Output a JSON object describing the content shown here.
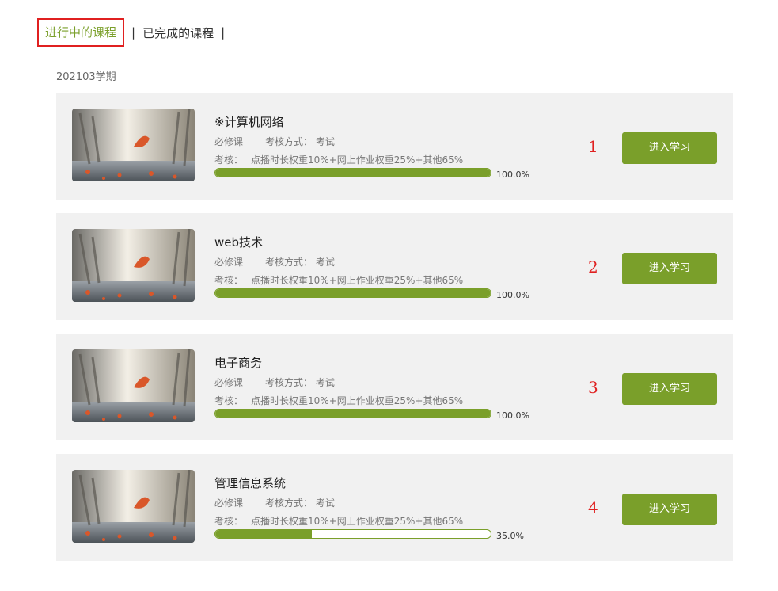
{
  "tabs": {
    "active_label": "进行中的课程",
    "sep": "|",
    "completed_label": "已完成的课程"
  },
  "semester": "202103学期",
  "courses": [
    {
      "title": "※计算机网络",
      "type": "必修课",
      "exam_mode": "考核方式：  考试",
      "assess_label": "考核：",
      "assess_detail": "点播时长权重10%+网上作业权重25%+其他65%",
      "progress_pct": 100,
      "progress_text": "100.0%",
      "annotation": "1",
      "enter_label": "进入学习"
    },
    {
      "title": "web技术",
      "type": "必修课",
      "exam_mode": "考核方式：  考试",
      "assess_label": "考核：",
      "assess_detail": "点播时长权重10%+网上作业权重25%+其他65%",
      "progress_pct": 100,
      "progress_text": "100.0%",
      "annotation": "2",
      "enter_label": "进入学习"
    },
    {
      "title": "电子商务",
      "type": "必修课",
      "exam_mode": "考核方式：  考试",
      "assess_label": "考核：",
      "assess_detail": "点播时长权重10%+网上作业权重25%+其他65%",
      "progress_pct": 100,
      "progress_text": "100.0%",
      "annotation": "3",
      "enter_label": "进入学习"
    },
    {
      "title": "管理信息系统",
      "type": "必修课",
      "exam_mode": "考核方式：  考试",
      "assess_label": "考核：",
      "assess_detail": "点播时长权重10%+网上作业权重25%+其他65%",
      "progress_pct": 35,
      "progress_text": "35.0%",
      "annotation": "4",
      "enter_label": "进入学习"
    }
  ],
  "colors": {
    "accent": "#7a9f2a",
    "highlight_box": "#e02020",
    "card_bg": "#f1f1f1"
  }
}
